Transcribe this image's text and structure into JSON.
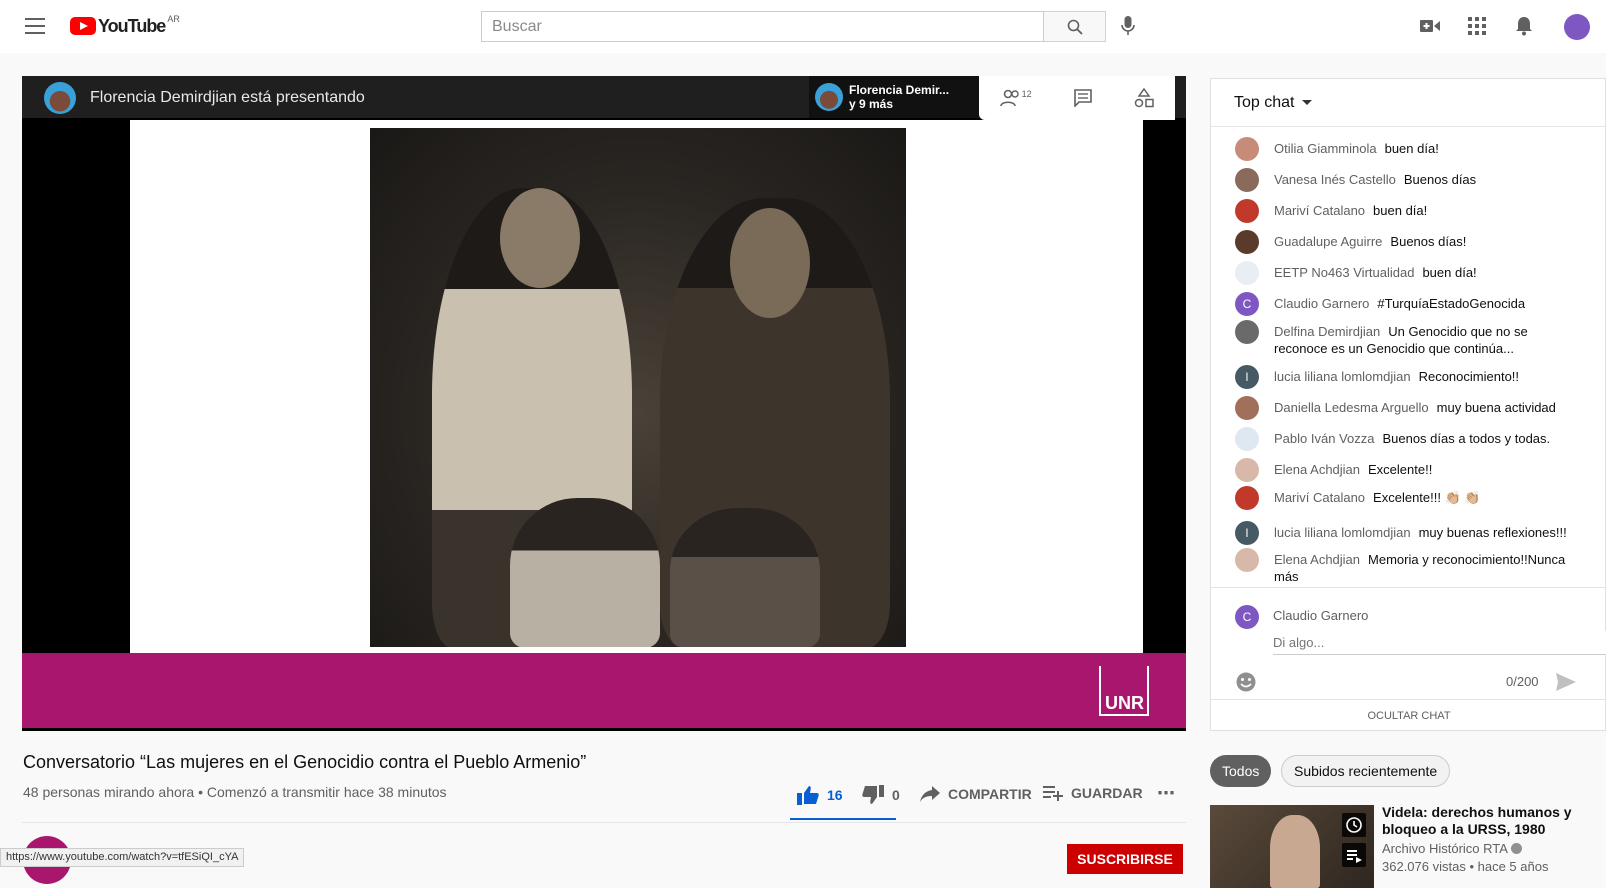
{
  "header": {
    "logo_text": "YouTube",
    "region": "AR",
    "search_placeholder": "Buscar"
  },
  "player": {
    "presenter_banner": "Florencia Demirdjian está presentando",
    "presenter_name": "Florencia Demir...",
    "presenter_more": "y 9 más",
    "participants_count": "12",
    "band_color": "#a8166e",
    "logo_text": "UNR"
  },
  "video": {
    "title": "Conversatorio “Las mujeres en el Genocidio contra el Pueblo Armenio”",
    "meta": "48 personas mirando ahora • Comenzó a transmitir hace 38 minutos",
    "likes": "16",
    "dislikes": "0",
    "share_label": "COMPARTIR",
    "save_label": "GUARDAR",
    "subscribe_label": "SUSCRIBIRSE"
  },
  "status_url": "https://www.youtube.com/watch?v=tfESiQI_cYA",
  "chat": {
    "header": "Top chat",
    "messages": [
      {
        "author": "Otilia Giamminola",
        "text": "buen día!",
        "avatar_color": "#c78b7a",
        "initial": ""
      },
      {
        "author": "Vanesa Inés Castello",
        "text": "Buenos días",
        "avatar_color": "#8a6a5a",
        "initial": ""
      },
      {
        "author": "Mariví Catalano",
        "text": "buen día!",
        "avatar_color": "#c0392b",
        "initial": ""
      },
      {
        "author": "Guadalupe Aguirre",
        "text": "Buenos días!",
        "avatar_color": "#5a3a2a",
        "initial": ""
      },
      {
        "author": "EETP No463 Virtualidad",
        "text": "buen día!",
        "avatar_color": "#e8eef4",
        "initial": ""
      },
      {
        "author": "Claudio Garnero",
        "text": "#TurquíaEstadoGenocida",
        "avatar_color": "#7e57c2",
        "initial": "C"
      },
      {
        "author": "Delfina Demirdjian",
        "text": "Un Genocidio que no se reconoce es un Genocidio que continúa...",
        "avatar_color": "#6a6a6a",
        "initial": ""
      },
      {
        "author": "lucia liliana lomlomdjian",
        "text": "Reconocimiento!!",
        "avatar_color": "#455a64",
        "initial": "l"
      },
      {
        "author": "Daniella Ledesma Arguello",
        "text": "muy buena actividad",
        "avatar_color": "#a0705a",
        "initial": ""
      },
      {
        "author": "Pablo Iván Vozza",
        "text": "Buenos días a todos y todas.",
        "avatar_color": "#dfe8f0",
        "initial": ""
      },
      {
        "author": "Elena Achdjian",
        "text": "Excelente!!",
        "avatar_color": "#d8b8a8",
        "initial": ""
      },
      {
        "author": "Mariví Catalano",
        "text": "Excelente!!! 👏🏼 👏🏼",
        "avatar_color": "#c0392b",
        "initial": ""
      },
      {
        "author": "lucia liliana lomlomdjian",
        "text": "muy buenas reflexiones!!!",
        "avatar_color": "#455a64",
        "initial": "l"
      },
      {
        "author": "Elena Achdjian",
        "text": "Memoria y reconocimiento!!Nunca más",
        "avatar_color": "#d8b8a8",
        "initial": ""
      }
    ],
    "compose_name": "Claudio Garnero",
    "compose_initial": "C",
    "compose_placeholder": "Di algo...",
    "char_count": "0/200",
    "hide_label": "OCULTAR CHAT"
  },
  "chips": [
    "Todos",
    "Subidos recientemente"
  ],
  "recommendation": {
    "title": "Videla: derechos humanos y bloqueo a la URSS, 1980",
    "channel": "Archivo Histórico RTA",
    "views": "362.076 vistas • hace 5 años"
  }
}
